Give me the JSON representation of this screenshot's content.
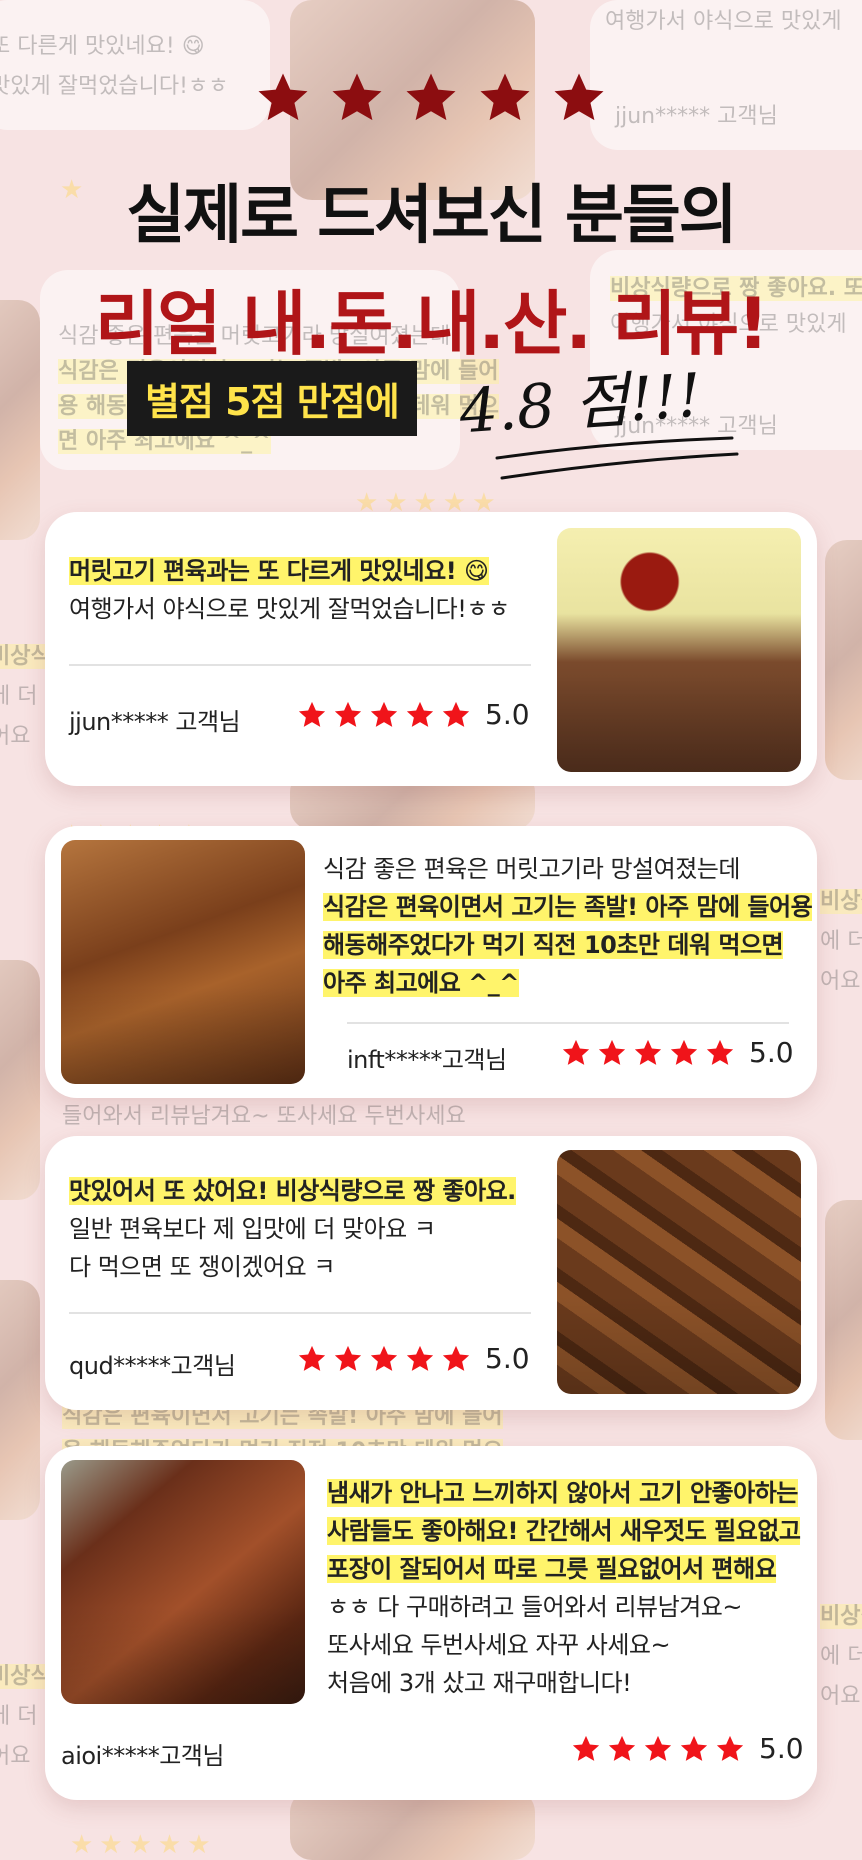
{
  "header": {
    "title_line1": "실제로 드셔보신 분들의",
    "title_line2": "리얼 내.돈.내.산. 리뷰!",
    "rating_label": "별점 5점 만점에",
    "rating_value": "4.8 점!!!",
    "star_color": "#8c0d10"
  },
  "reviews": [
    {
      "lines": [
        {
          "text": "머릿고기 편육과는 또 다르게 맛있네요! 😋",
          "highlight": true
        },
        {
          "text": "여행가서 야식으로 맛있게 잘먹었습니다!ㅎㅎ",
          "highlight": false
        }
      ],
      "user": "jjun***** 고객님",
      "score": "5.0"
    },
    {
      "lines": [
        {
          "text": "식감 좋은 편육은 머릿고기라 망설여졌는데",
          "highlight": false
        },
        {
          "text": "식감은 편육이면서 고기는 족발! 아주 맘에 들어용",
          "highlight": true
        },
        {
          "text": "해동해주었다가 먹기 직전 10초만 데워 먹으면",
          "highlight": true
        },
        {
          "text": "아주 최고에요 ^_^",
          "highlight": true
        }
      ],
      "user": "inft*****고객님",
      "score": "5.0"
    },
    {
      "lines": [
        {
          "text": "맛있어서 또 샀어요! 비상식량으로 짱 좋아요.",
          "highlight": true
        },
        {
          "text": "일반 편육보다 제 입맛에 더 맞아요 ㅋ",
          "highlight": false
        },
        {
          "text": "다 먹으면 또 쟁이겠어요 ㅋ",
          "highlight": false
        }
      ],
      "user": "qud*****고객님",
      "score": "5.0"
    },
    {
      "lines": [
        {
          "text": "냄새가 안나고 느끼하지 않아서 고기 안좋아하는",
          "highlight": true
        },
        {
          "text": "사람들도 좋아해요! 간간해서 새우젓도 필요없고",
          "highlight": true
        },
        {
          "text": "포장이 잘되어서 따로 그릇 필요없어서 편해요",
          "highlight": true
        },
        {
          "text": "ㅎㅎ 다 구매하려고 들어와서 리뷰남겨요~",
          "highlight": false
        },
        {
          "text": "또사세요 두번사세요 자꾸 사세요~",
          "highlight": false
        },
        {
          "text": "처음에 3개 샀고 재구매합니다!",
          "highlight": false
        }
      ],
      "user": "aioi*****고객님",
      "score": "5.0"
    }
  ],
  "colors": {
    "title_red": "#b01518",
    "star_red": "#f0141a",
    "highlight_yellow": "#fff46b",
    "background_pink": "#f7e3e3"
  }
}
